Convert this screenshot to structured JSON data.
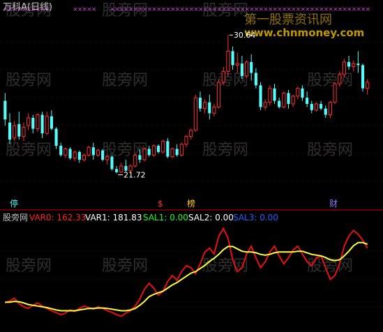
{
  "colors": {
    "background": "#000000",
    "grid": "#8b0000",
    "candle_up": "#ff3030",
    "candle_down": "#54fcfc",
    "marker": "#cc44cc",
    "title": "#c0c0c0",
    "var0": "#ff2020",
    "var1": "#ffffff",
    "sal1": "#20ff20",
    "sal2": "#ffffff",
    "sal3": "#2060ff",
    "line_red": "#e81010",
    "line_yellow": "#ffff40",
    "watermark": "#555555"
  },
  "header": {
    "title": "万科A(日线)"
  },
  "price_panel": {
    "y_range": [
      19.5,
      32.0
    ],
    "high_label": "30.64",
    "low_label": "21.72",
    "badges": [
      {
        "text": "停",
        "color": "#54fcfc"
      },
      {
        "text": "$",
        "color": "#ff3030"
      },
      {
        "text": "榜",
        "color": "#ffcc00"
      },
      {
        "text": "财",
        "color": "#8080ff"
      }
    ]
  },
  "indicator_panel": {
    "name": "股旁网",
    "var0_label": "VAR0: 162.33",
    "var1_label": "VAR1: 181.83",
    "sal1_label": "SAL1: 0.00",
    "sal2_label": "SAL2: 0.00",
    "sal3_label": "SAL3: 0.00",
    "y_range": [
      0,
      260
    ]
  },
  "watermarks": [
    "股旁网",
    "www.chnmoney.com",
    "第一股票资讯网"
  ],
  "chart_data": {
    "type": "candlestick",
    "title": "万科A(日线)",
    "annotations": [
      "30.64",
      "21.72"
    ],
    "candles": [
      {
        "o": 26.4,
        "h": 26.9,
        "c": 25.2,
        "l": 24.8
      },
      {
        "o": 25.0,
        "h": 25.6,
        "c": 23.9,
        "l": 23.6
      },
      {
        "o": 24.0,
        "h": 25.1,
        "c": 24.8,
        "l": 23.8
      },
      {
        "o": 24.9,
        "h": 25.7,
        "c": 24.1,
        "l": 23.9
      },
      {
        "o": 24.1,
        "h": 25.0,
        "c": 24.7,
        "l": 23.8
      },
      {
        "o": 24.8,
        "h": 25.6,
        "c": 25.3,
        "l": 24.5
      },
      {
        "o": 25.3,
        "h": 25.5,
        "c": 24.6,
        "l": 24.3
      },
      {
        "o": 24.6,
        "h": 25.6,
        "c": 25.5,
        "l": 24.4
      },
      {
        "o": 25.5,
        "h": 25.7,
        "c": 24.3,
        "l": 24.0
      },
      {
        "o": 24.3,
        "h": 25.7,
        "c": 25.4,
        "l": 24.2
      },
      {
        "o": 25.4,
        "h": 25.8,
        "c": 24.6,
        "l": 24.5
      },
      {
        "o": 24.6,
        "h": 24.7,
        "c": 23.5,
        "l": 23.3
      },
      {
        "o": 23.5,
        "h": 23.7,
        "c": 22.9,
        "l": 22.8
      },
      {
        "o": 22.9,
        "h": 23.4,
        "c": 23.3,
        "l": 22.7
      },
      {
        "o": 23.3,
        "h": 23.4,
        "c": 22.7,
        "l": 22.6
      },
      {
        "o": 22.7,
        "h": 23.2,
        "c": 23.1,
        "l": 22.5
      },
      {
        "o": 23.1,
        "h": 23.2,
        "c": 22.6,
        "l": 22.4
      },
      {
        "o": 22.6,
        "h": 23.0,
        "c": 22.9,
        "l": 22.5
      },
      {
        "o": 22.9,
        "h": 23.5,
        "c": 23.4,
        "l": 22.8
      },
      {
        "o": 23.4,
        "h": 23.7,
        "c": 22.9,
        "l": 22.6
      },
      {
        "o": 22.9,
        "h": 23.3,
        "c": 23.2,
        "l": 22.8
      },
      {
        "o": 23.2,
        "h": 23.3,
        "c": 22.6,
        "l": 22.5
      },
      {
        "o": 22.6,
        "h": 22.9,
        "c": 22.8,
        "l": 22.3
      },
      {
        "o": 22.8,
        "h": 22.9,
        "c": 22.0,
        "l": 21.9
      },
      {
        "o": 22.0,
        "h": 22.2,
        "c": 21.8,
        "l": 21.72
      },
      {
        "o": 21.8,
        "h": 22.4,
        "c": 22.2,
        "l": 21.75
      },
      {
        "o": 22.2,
        "h": 22.6,
        "c": 21.9,
        "l": 21.8
      },
      {
        "o": 21.9,
        "h": 22.3,
        "c": 22.2,
        "l": 21.8
      },
      {
        "o": 22.2,
        "h": 23.0,
        "c": 22.9,
        "l": 22.1
      },
      {
        "o": 22.9,
        "h": 23.3,
        "c": 22.6,
        "l": 22.4
      },
      {
        "o": 22.6,
        "h": 23.4,
        "c": 23.3,
        "l": 22.5
      },
      {
        "o": 23.3,
        "h": 23.5,
        "c": 22.9,
        "l": 22.8
      },
      {
        "o": 22.9,
        "h": 23.6,
        "c": 23.5,
        "l": 22.8
      },
      {
        "o": 23.5,
        "h": 23.6,
        "c": 23.1,
        "l": 23.0
      },
      {
        "o": 23.1,
        "h": 23.9,
        "c": 23.8,
        "l": 23.0
      },
      {
        "o": 23.8,
        "h": 24.0,
        "c": 22.8,
        "l": 22.7
      },
      {
        "o": 22.8,
        "h": 23.4,
        "c": 23.3,
        "l": 22.7
      },
      {
        "o": 23.3,
        "h": 23.6,
        "c": 22.9,
        "l": 22.8
      },
      {
        "o": 22.9,
        "h": 23.7,
        "c": 23.6,
        "l": 22.8
      },
      {
        "o": 23.6,
        "h": 24.2,
        "c": 24.1,
        "l": 23.4
      },
      {
        "o": 24.1,
        "h": 24.6,
        "c": 24.5,
        "l": 23.9
      },
      {
        "o": 24.5,
        "h": 26.8,
        "c": 26.6,
        "l": 24.4
      },
      {
        "o": 26.6,
        "h": 27.0,
        "c": 25.9,
        "l": 25.7
      },
      {
        "o": 25.9,
        "h": 26.5,
        "c": 26.3,
        "l": 25.6
      },
      {
        "o": 26.3,
        "h": 26.8,
        "c": 25.6,
        "l": 25.2
      },
      {
        "o": 25.6,
        "h": 26.2,
        "c": 26.0,
        "l": 25.4
      },
      {
        "o": 26.0,
        "h": 27.8,
        "c": 27.6,
        "l": 25.9
      },
      {
        "o": 27.6,
        "h": 28.6,
        "c": 28.3,
        "l": 27.4
      },
      {
        "o": 28.3,
        "h": 30.64,
        "c": 29.6,
        "l": 28.0
      },
      {
        "o": 29.6,
        "h": 29.9,
        "c": 28.7,
        "l": 28.4
      },
      {
        "o": 28.7,
        "h": 29.5,
        "c": 28.8,
        "l": 28.2
      },
      {
        "o": 28.8,
        "h": 29.3,
        "c": 28.0,
        "l": 27.8
      },
      {
        "o": 28.0,
        "h": 29.0,
        "c": 28.9,
        "l": 27.9
      },
      {
        "o": 28.9,
        "h": 29.4,
        "c": 28.2,
        "l": 27.7
      },
      {
        "o": 28.2,
        "h": 28.5,
        "c": 27.4,
        "l": 27.2
      },
      {
        "o": 27.4,
        "h": 27.6,
        "c": 26.0,
        "l": 25.8
      },
      {
        "o": 26.0,
        "h": 26.5,
        "c": 26.3,
        "l": 25.8
      },
      {
        "o": 26.3,
        "h": 27.4,
        "c": 27.2,
        "l": 26.1
      },
      {
        "o": 27.2,
        "h": 27.5,
        "c": 26.4,
        "l": 26.2
      },
      {
        "o": 26.4,
        "h": 26.6,
        "c": 26.0,
        "l": 25.9
      },
      {
        "o": 26.0,
        "h": 27.0,
        "c": 26.9,
        "l": 25.9
      },
      {
        "o": 26.9,
        "h": 27.1,
        "c": 26.2,
        "l": 25.9
      },
      {
        "o": 26.2,
        "h": 26.8,
        "c": 26.7,
        "l": 26.0
      },
      {
        "o": 26.7,
        "h": 27.3,
        "c": 27.2,
        "l": 26.5
      },
      {
        "o": 27.2,
        "h": 27.4,
        "c": 26.6,
        "l": 26.4
      },
      {
        "o": 26.6,
        "h": 27.0,
        "c": 26.2,
        "l": 26.0
      },
      {
        "o": 26.2,
        "h": 26.4,
        "c": 25.8,
        "l": 25.6
      },
      {
        "o": 25.8,
        "h": 26.3,
        "c": 26.2,
        "l": 25.7
      },
      {
        "o": 26.2,
        "h": 26.4,
        "c": 25.9,
        "l": 25.8
      },
      {
        "o": 25.9,
        "h": 26.1,
        "c": 25.5,
        "l": 25.3
      },
      {
        "o": 25.5,
        "h": 26.4,
        "c": 26.3,
        "l": 25.3
      },
      {
        "o": 26.3,
        "h": 27.6,
        "c": 27.5,
        "l": 26.2
      },
      {
        "o": 27.5,
        "h": 28.3,
        "c": 28.1,
        "l": 27.3
      },
      {
        "o": 28.1,
        "h": 29.1,
        "c": 28.9,
        "l": 27.9
      },
      {
        "o": 28.9,
        "h": 29.3,
        "c": 28.6,
        "l": 28.4
      },
      {
        "o": 28.6,
        "h": 29.0,
        "c": 28.8,
        "l": 28.3
      },
      {
        "o": 28.8,
        "h": 29.6,
        "c": 28.7,
        "l": 28.2
      },
      {
        "o": 28.7,
        "h": 28.8,
        "c": 27.2,
        "l": 27.0
      },
      {
        "o": 27.2,
        "h": 27.8,
        "c": 27.6,
        "l": 26.8
      }
    ],
    "series": [
      {
        "name": "VAR0",
        "values": [
          60,
          65,
          72,
          58,
          50,
          46,
          54,
          60,
          52,
          46,
          40,
          35,
          30,
          34,
          42,
          38,
          46,
          52,
          48,
          44,
          50,
          46,
          40,
          36,
          30,
          26,
          34,
          40,
          52,
          70,
          95,
          110,
          98,
          80,
          90,
          115,
          130,
          118,
          140,
          155,
          150,
          135,
          160,
          190,
          200,
          185,
          230,
          250,
          225,
          170,
          140,
          150,
          185,
          205,
          175,
          150,
          165,
          190,
          205,
          180,
          160,
          175,
          195,
          205,
          185,
          165,
          155,
          175,
          180,
          150,
          120,
          130,
          160,
          205,
          230,
          245,
          235,
          220,
          200
        ]
      },
      {
        "name": "VAR1",
        "values": [
          62,
          62,
          64,
          63,
          60,
          56,
          54,
          52,
          50,
          48,
          45,
          42,
          40,
          40,
          40,
          40,
          42,
          44,
          46,
          46,
          47,
          47,
          46,
          44,
          42,
          40,
          40,
          42,
          46,
          54,
          64,
          76,
          82,
          86,
          90,
          98,
          106,
          112,
          120,
          128,
          136,
          140,
          148,
          156,
          166,
          174,
          184,
          196,
          204,
          204,
          198,
          192,
          190,
          190,
          188,
          184,
          182,
          184,
          188,
          190,
          190,
          190,
          190,
          192,
          192,
          188,
          184,
          182,
          180,
          176,
          170,
          168,
          170,
          180,
          192,
          206,
          214,
          214,
          210
        ]
      }
    ],
    "ylim_price": [
      19.5,
      32.0
    ],
    "ylim_indicator": [
      0,
      260
    ]
  }
}
